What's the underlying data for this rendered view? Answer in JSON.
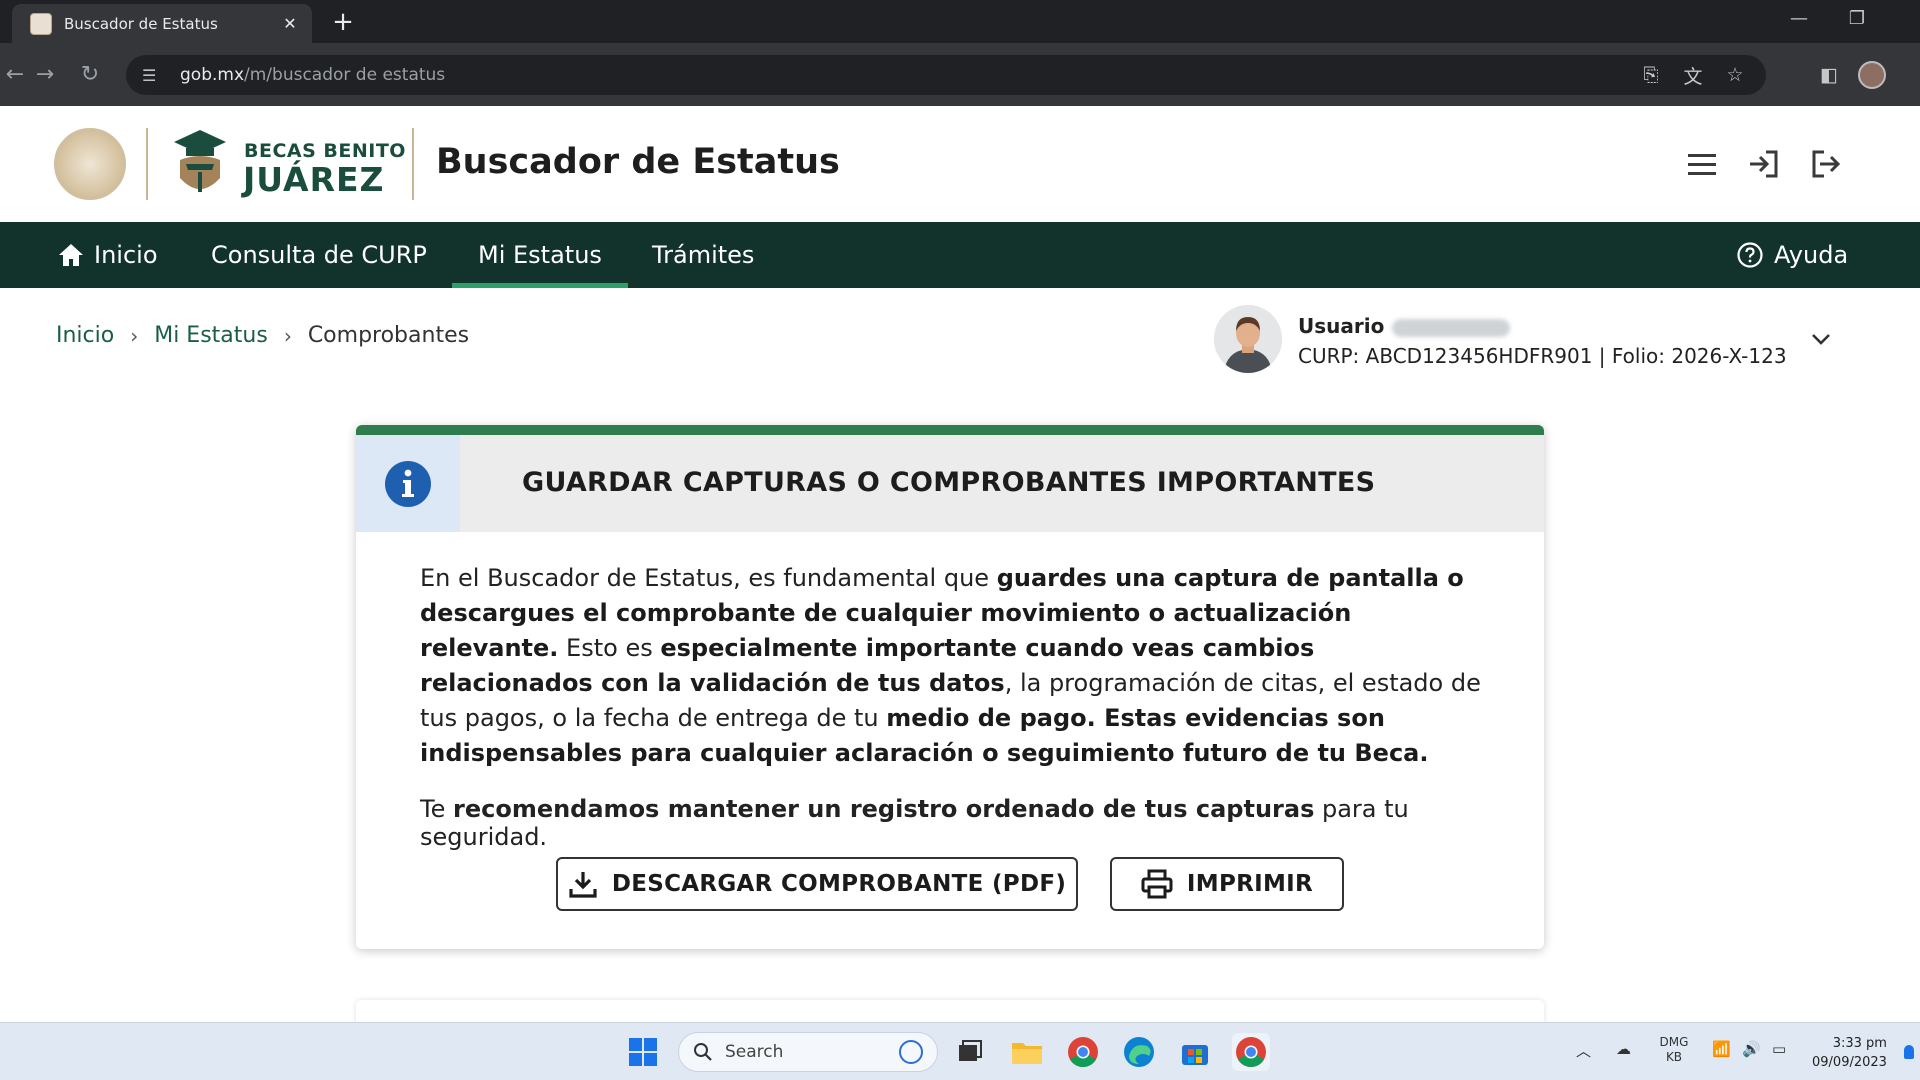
{
  "browser": {
    "tab_title": "Buscador de Estatus",
    "tab_close": "✕",
    "new_tab": "+",
    "url_domain": "gob.mx",
    "url_path": "/m/buscador de estatus"
  },
  "header": {
    "logo_line1": "BECAS BENITO",
    "logo_line2": "JUÁREZ",
    "title": "Buscador de Estatus"
  },
  "nav": {
    "items": [
      {
        "label": "Inicio",
        "icon": "home-icon"
      },
      {
        "label": "Consulta de CURP"
      },
      {
        "label": "Mi Estatus",
        "active": true
      },
      {
        "label": "Trámites"
      }
    ],
    "help_label": "Ayuda"
  },
  "breadcrumb": {
    "items": [
      "Inicio",
      "Mi Estatus"
    ],
    "current": "Comprobantes"
  },
  "user": {
    "label": "Usuario",
    "curp_line": "CURP: ABCD123456HDFR901 | Folio: 2026-X-123"
  },
  "card": {
    "title": "GUARDAR CAPTURAS O COMPROBANTES IMPORTANTES",
    "p1": [
      {
        "t": "En el Buscador de Estatus, es fundamental que ",
        "b": false
      },
      {
        "t": "guardes una captura de pantalla o descargues el comprobante de cualquier movimiento o actualización relevante.",
        "b": true
      },
      {
        "t": " Esto es ",
        "b": false
      },
      {
        "t": "especialmente importante cuando veas cambios relacionados con la validación de tus datos",
        "b": true
      },
      {
        "t": ", la programación de citas, el estado de tus pagos, o la fecha de entrega de tu ",
        "b": false
      },
      {
        "t": "medio de pago. Estas evidencias son indispensables para cualquier aclaración o seguimiento futuro de tu Beca.",
        "b": true
      }
    ],
    "p2": [
      {
        "t": "Te ",
        "b": false
      },
      {
        "t": "recomendamos mantener un registro ordenado de tus capturas",
        "b": true
      },
      {
        "t": " para tu seguridad.",
        "b": false
      }
    ],
    "btn_download": "DESCARGAR COMPROBANTE (PDF)",
    "btn_print": "IMPRIMIR"
  },
  "taskbar": {
    "search_placeholder": "Search",
    "tray_lang_1": "DMG",
    "tray_lang_2": "KB",
    "time": "3:33 pm",
    "date": "09/09/2023"
  },
  "colors": {
    "nav_bg": "#11332b",
    "brand_green": "#1b4d3e",
    "accent_green": "#2f7d4f",
    "info_blue": "#1f5fb0"
  }
}
